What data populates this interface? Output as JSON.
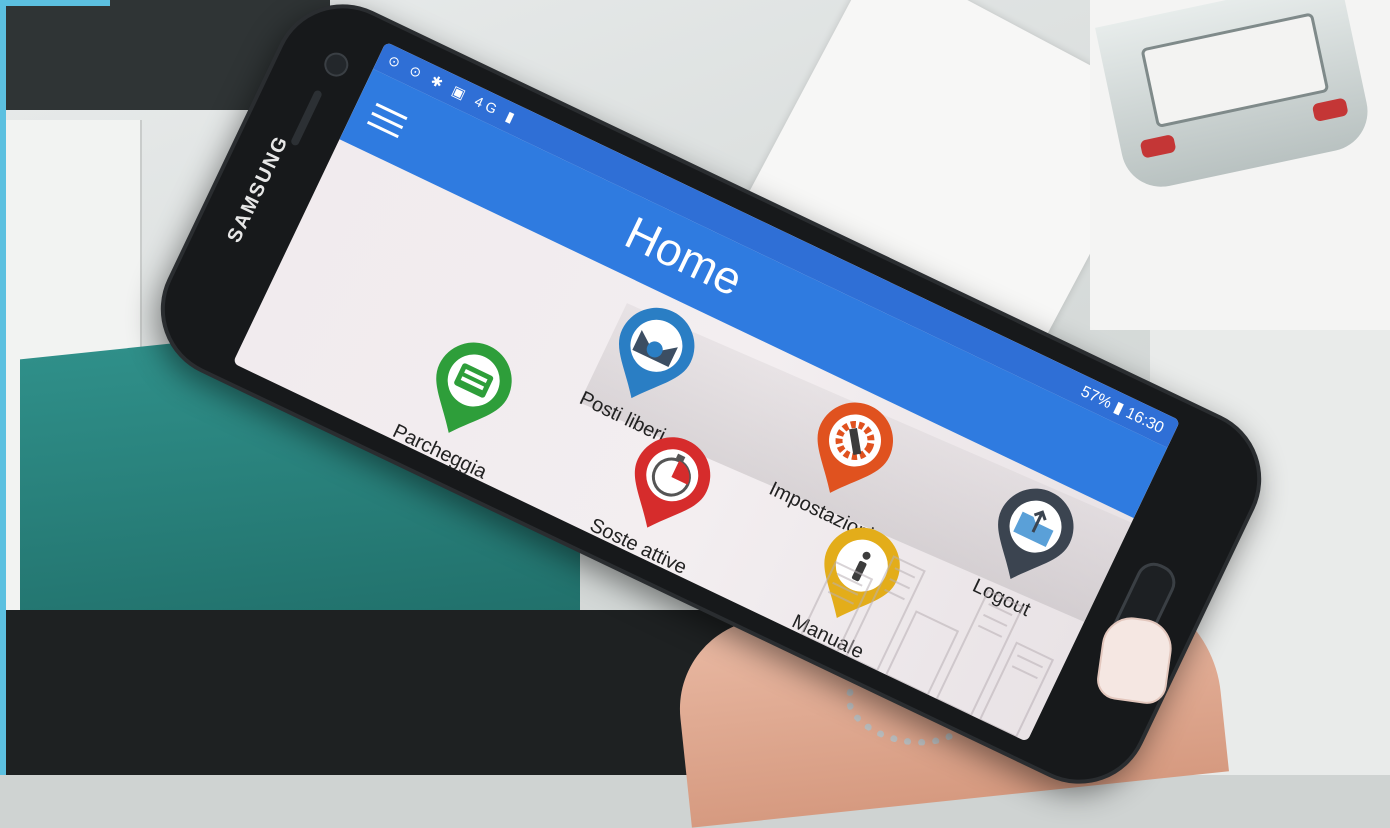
{
  "phone": {
    "brand": "SAMSUNG",
    "status": {
      "icons": "⊙ ⊙ ✱ ▣ 4G ▮",
      "battery_time": "57% ▮ 16:30"
    },
    "appbar": {
      "title": "Home"
    },
    "apps": [
      {
        "label": "Posti liberi",
        "icon": "parking-map-pin-icon",
        "color": "#2a7ec4"
      },
      {
        "label": "Impostazioni",
        "icon": "settings-gear-wrench-icon",
        "color": "#e0521f"
      },
      {
        "label": "Logout",
        "icon": "logout-folder-icon",
        "color": "#3b4450"
      },
      {
        "label": "Parcheggia",
        "icon": "parking-ticket-icon",
        "color": "#2e9e3a"
      },
      {
        "label": "Soste attive",
        "icon": "timer-icon",
        "color": "#d62c2c"
      },
      {
        "label": "Manuale",
        "icon": "info-icon",
        "color": "#e3ad1a"
      }
    ]
  }
}
